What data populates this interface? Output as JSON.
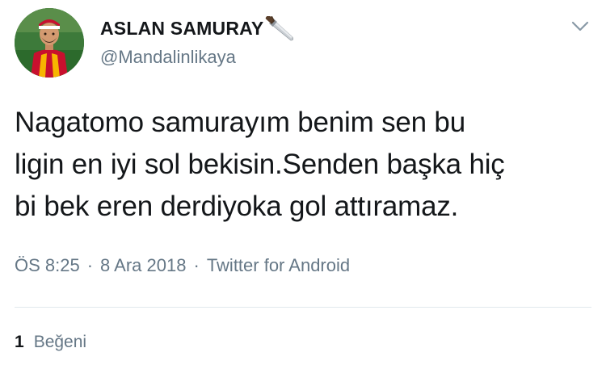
{
  "tweet": {
    "display_name": "ASLAN SAMURAY",
    "name_emoji": "knife-icon",
    "handle": "@Mandalinlikaya",
    "text": "Nagatomo samurayım benim sen bu\nligin en iyi sol bekisin.Senden başka hiç\nbi bek eren derdiyoka gol attıramaz.",
    "time": "ÖS 8:25",
    "date": "8 Ara 2018",
    "source": "Twitter for Android",
    "separator": "·",
    "likes_count": "1",
    "likes_label": "Beğeni"
  },
  "colors": {
    "text_primary": "#14171a",
    "text_secondary": "#657786",
    "divider": "#e1e8ed",
    "jersey_red": "#c8102e",
    "jersey_yellow": "#f7b500"
  }
}
